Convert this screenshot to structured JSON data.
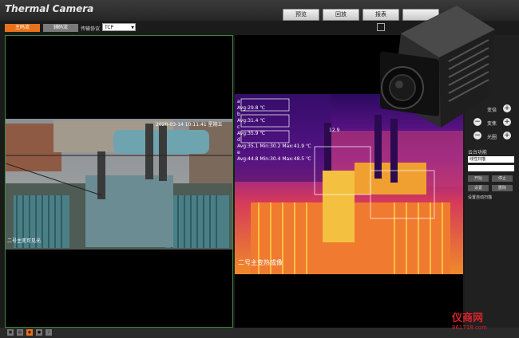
{
  "app": {
    "title": "Thermal Camera"
  },
  "top_tabs": [
    {
      "label": "预览"
    },
    {
      "label": "回放"
    },
    {
      "label": "报表"
    },
    {
      "label": ""
    }
  ],
  "toolbar": {
    "main_stream_label": "主码流",
    "sub_stream_label": "辅码流",
    "protocol_label": "传输协议",
    "protocol_value": "TCP"
  },
  "left_view": {
    "timestamp": "2020-03-14 10:11:41 星期五",
    "caption": "二号主变可见光"
  },
  "right_view": {
    "measure_lines": [
      "a",
      "Avg:29.8 ℃",
      "b",
      "Avg:31.4 ℃",
      "c",
      "Avg:35.9 ℃",
      "d",
      "Avg:35.1 Min:30.2 Max:41.9 ℃",
      "e",
      "Avg:44.8 Min:30.4 Max:48.5 ℃"
    ],
    "spot_label": "12.9",
    "caption": "二号主变热成像"
  },
  "ptz": {
    "zoom_label": "变倍",
    "focus_label": "变焦",
    "iris_label": "光圈",
    "plus": "+",
    "minus": "−"
  },
  "panel": {
    "section_title": "云台功能",
    "scan_select": "线性扫描",
    "buttons": [
      "开始",
      "停止",
      "设置",
      "删除"
    ],
    "bottom_label": "设置自动扫描"
  },
  "watermark": {
    "brand": "仪商网",
    "url": "861718.com"
  },
  "colors": {
    "accent": "#e8711c",
    "border_green": "#3b8a3b"
  }
}
